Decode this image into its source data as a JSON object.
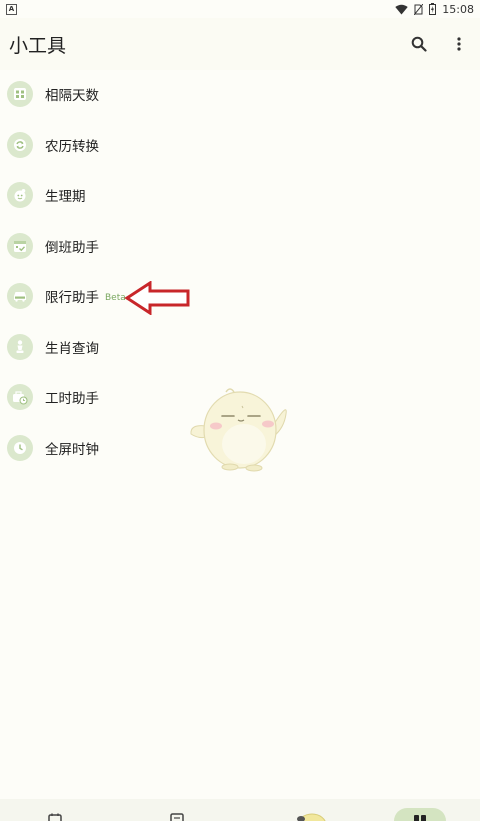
{
  "status_bar": {
    "time": "15:08"
  },
  "app_bar": {
    "title": "小工具"
  },
  "tools": [
    {
      "label": "相隔天数",
      "icon": "calendar-grid-icon"
    },
    {
      "label": "农历转换",
      "icon": "sync-icon"
    },
    {
      "label": "生理期",
      "icon": "face-icon"
    },
    {
      "label": "倒班助手",
      "icon": "calendar-check-icon"
    },
    {
      "label": "限行助手",
      "icon": "car-icon",
      "badge": "Beta"
    },
    {
      "label": "生肖查询",
      "icon": "chess-pawn-icon"
    },
    {
      "label": "工时助手",
      "icon": "briefcase-clock-icon"
    },
    {
      "label": "全屏时钟",
      "icon": "clock-icon"
    }
  ],
  "colors": {
    "accent": "#7aa860",
    "icon_bg": "#dbe8cd",
    "arrow": "#c8262a",
    "background": "#fdfdf8"
  }
}
